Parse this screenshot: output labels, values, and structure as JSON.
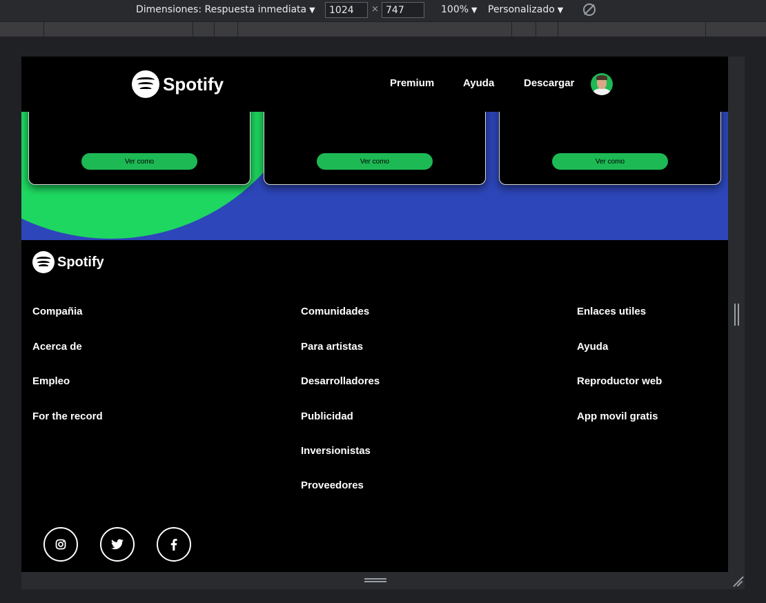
{
  "devtools": {
    "dimensions_label": "Dimensiones: Respuesta inmediata",
    "width": "1024",
    "height": "747",
    "times": "×",
    "zoom": "100%",
    "throttle": "Personalizado"
  },
  "navbar": {
    "logo_text": "Spotify",
    "links": [
      "Premium",
      "Ayuda",
      "Descargar"
    ]
  },
  "cards": [
    {
      "button": "Ver como"
    },
    {
      "button": "Ver como"
    },
    {
      "button": "Ver como"
    }
  ],
  "footer": {
    "logo_text": "Spotify",
    "columns": [
      {
        "title": "Compañia",
        "links": [
          "Acerca de",
          "Empleo",
          "For the record"
        ]
      },
      {
        "title": "Comunidades",
        "links": [
          "Para artistas",
          "Desarrolladores",
          "Publicidad",
          "Inversionistas",
          "Proveedores"
        ]
      },
      {
        "title": "Enlaces utiles",
        "links": [
          "Ayuda",
          "Reproductor web",
          "App movil gratis"
        ]
      }
    ],
    "social_icons": [
      "instagram-icon",
      "twitter-icon",
      "facebook-icon"
    ]
  },
  "colors": {
    "spotify_green": "#1db954",
    "circle_green": "#1ed760",
    "band_blue": "#2d46b9"
  }
}
